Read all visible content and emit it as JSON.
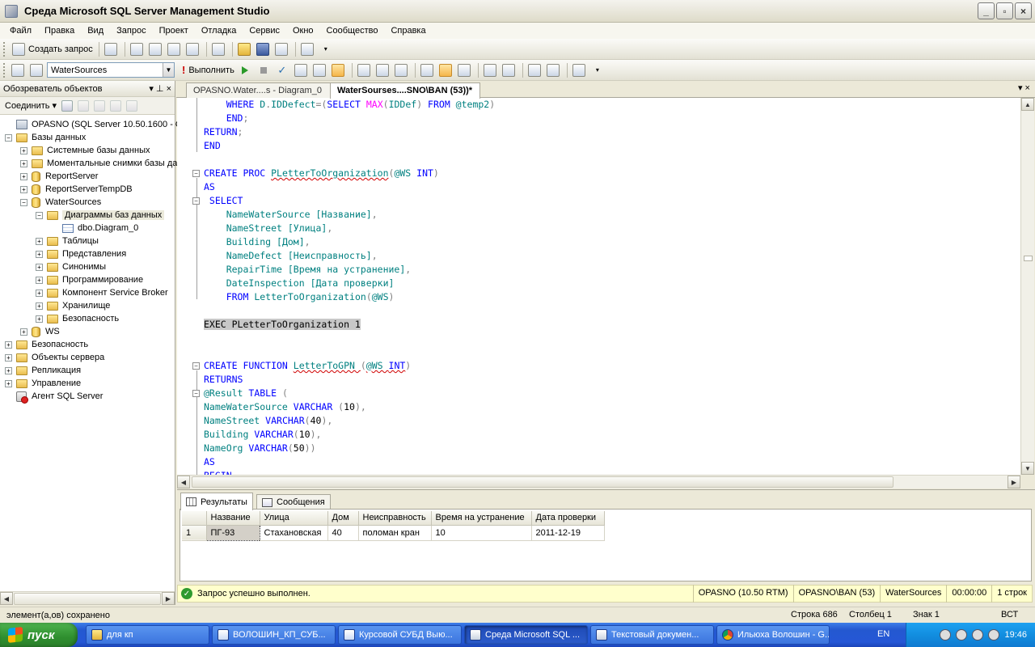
{
  "window": {
    "title": "Среда Microsoft SQL Server Management Studio",
    "buttons": [
      "_",
      "▫",
      "×"
    ]
  },
  "menu": [
    "Файл",
    "Правка",
    "Вид",
    "Запрос",
    "Проект",
    "Отладка",
    "Сервис",
    "Окно",
    "Сообщество",
    "Справка"
  ],
  "toolbar1": {
    "new_query_label": "Создать запрос"
  },
  "toolbar2": {
    "database": "WaterSources",
    "execute_label": "Выполнить"
  },
  "object_explorer": {
    "title": "Обозреватель объектов",
    "pin": "▾ ⊥ ×",
    "connect_label": "Соединить ▾",
    "tree": [
      {
        "level": 0,
        "icon": "server-icon",
        "exp": "none",
        "label": "OPASNO (SQL Server 10.50.1600 - OPASN"
      },
      {
        "level": 0,
        "icon": "folder-icon",
        "exp": "−",
        "label": "Базы данных"
      },
      {
        "level": 1,
        "icon": "folder-icon",
        "exp": "+",
        "label": "Системные базы данных"
      },
      {
        "level": 1,
        "icon": "folder-icon",
        "exp": "+",
        "label": "Моментальные снимки базы данн"
      },
      {
        "level": 1,
        "icon": "database-icon",
        "exp": "+",
        "label": "ReportServer"
      },
      {
        "level": 1,
        "icon": "database-icon",
        "exp": "+",
        "label": "ReportServerTempDB"
      },
      {
        "level": 1,
        "icon": "database-icon",
        "exp": "−",
        "label": "WaterSources"
      },
      {
        "level": 2,
        "icon": "folder-icon",
        "exp": "−",
        "label": "Диаграммы баз данных",
        "selected": true
      },
      {
        "level": 3,
        "icon": "diagram-icon",
        "exp": "none",
        "label": "dbo.Diagram_0"
      },
      {
        "level": 2,
        "icon": "folder-icon",
        "exp": "+",
        "label": "Таблицы"
      },
      {
        "level": 2,
        "icon": "folder-icon",
        "exp": "+",
        "label": "Представления"
      },
      {
        "level": 2,
        "icon": "folder-icon",
        "exp": "+",
        "label": "Синонимы"
      },
      {
        "level": 2,
        "icon": "folder-icon",
        "exp": "+",
        "label": "Программирование"
      },
      {
        "level": 2,
        "icon": "folder-icon",
        "exp": "+",
        "label": "Компонент Service Broker"
      },
      {
        "level": 2,
        "icon": "folder-icon",
        "exp": "+",
        "label": "Хранилище"
      },
      {
        "level": 2,
        "icon": "folder-icon",
        "exp": "+",
        "label": "Безопасность"
      },
      {
        "level": 1,
        "icon": "database-icon",
        "exp": "+",
        "label": "WS"
      },
      {
        "level": 0,
        "icon": "folder-icon",
        "exp": "+",
        "label": "Безопасность"
      },
      {
        "level": 0,
        "icon": "folder-icon",
        "exp": "+",
        "label": "Объекты сервера"
      },
      {
        "level": 0,
        "icon": "folder-icon",
        "exp": "+",
        "label": "Репликация"
      },
      {
        "level": 0,
        "icon": "folder-icon",
        "exp": "+",
        "label": "Управление"
      },
      {
        "level": 0,
        "icon": "agent-icon",
        "exp": "none",
        "label": "Агент SQL Server"
      }
    ]
  },
  "doc_tabs": {
    "inactive": "OPASNO.Water....s - Diagram_0",
    "active": "WaterSourses....SNO\\BAN (53))*",
    "controls": "▾ ×"
  },
  "editor": {
    "lines": [
      [
        [
          "    ",
          "tx"
        ],
        [
          "WHERE ",
          "kw"
        ],
        [
          "D",
          "id"
        ],
        [
          ".",
          "gr"
        ],
        [
          "IDDefect",
          "id"
        ],
        [
          "=(",
          "gr"
        ],
        [
          "SELECT ",
          "kw"
        ],
        [
          "MAX",
          "fn"
        ],
        [
          "(",
          "gr"
        ],
        [
          "IDDef",
          "id"
        ],
        [
          ") ",
          "gr"
        ],
        [
          "FROM ",
          "kw"
        ],
        [
          "@temp2",
          "id"
        ],
        [
          ")",
          "gr"
        ]
      ],
      [
        [
          "    ",
          "tx"
        ],
        [
          "END",
          "kw"
        ],
        [
          ";",
          "gr"
        ]
      ],
      [
        [
          "RETURN",
          "kw"
        ],
        [
          ";",
          "gr"
        ]
      ],
      [
        [
          "END",
          "kw"
        ]
      ],
      [
        [
          "",
          "tx"
        ]
      ],
      [
        [
          "CREATE ",
          "kw"
        ],
        [
          "PROC ",
          "kw"
        ],
        [
          "PLetterToOrganization",
          "id sq"
        ],
        [
          "(",
          "gr"
        ],
        [
          "@WS ",
          "id"
        ],
        [
          "INT",
          "kw"
        ],
        [
          ")",
          "gr"
        ]
      ],
      [
        [
          "AS",
          "kw"
        ]
      ],
      [
        [
          " SELECT",
          "kw"
        ]
      ],
      [
        [
          "    ",
          "tx"
        ],
        [
          "NameWaterSource ",
          "id"
        ],
        [
          "[Название]",
          "id"
        ],
        [
          ",",
          "gr"
        ]
      ],
      [
        [
          "    ",
          "tx"
        ],
        [
          "NameStreet ",
          "id"
        ],
        [
          "[Улица]",
          "id"
        ],
        [
          ",",
          "gr"
        ]
      ],
      [
        [
          "    ",
          "tx"
        ],
        [
          "Building ",
          "id"
        ],
        [
          "[Дом]",
          "id"
        ],
        [
          ",",
          "gr"
        ]
      ],
      [
        [
          "    ",
          "tx"
        ],
        [
          "NameDefect ",
          "id"
        ],
        [
          "[Неисправность]",
          "id"
        ],
        [
          ",",
          "gr"
        ]
      ],
      [
        [
          "    ",
          "tx"
        ],
        [
          "RepairTime ",
          "id"
        ],
        [
          "[Время на устранение]",
          "id"
        ],
        [
          ",",
          "gr"
        ]
      ],
      [
        [
          "    ",
          "tx"
        ],
        [
          "DateInspection ",
          "id"
        ],
        [
          "[Дата проверки]",
          "id"
        ]
      ],
      [
        [
          "    ",
          "tx"
        ],
        [
          "FROM ",
          "kw"
        ],
        [
          "LetterToOrganization",
          "id"
        ],
        [
          "(",
          "gr"
        ],
        [
          "@WS",
          "id"
        ],
        [
          ")",
          "gr"
        ]
      ],
      [
        [
          "",
          "tx"
        ]
      ],
      [
        [
          "EXEC PLetterToOrganization 1",
          "tx hl"
        ]
      ],
      [
        [
          "",
          "tx"
        ]
      ],
      [
        [
          "",
          "tx"
        ]
      ],
      [
        [
          "CREATE ",
          "kw"
        ],
        [
          "FUNCTION ",
          "kw"
        ],
        [
          "LetterToGPN ",
          "id sq"
        ],
        [
          "(",
          "gr"
        ],
        [
          "@WS ",
          "id sq"
        ],
        [
          "INT",
          "kw sq"
        ],
        [
          ")",
          "gr"
        ]
      ],
      [
        [
          "RETURNS",
          "kw"
        ]
      ],
      [
        [
          "@Result ",
          "id"
        ],
        [
          "TABLE ",
          "kw"
        ],
        [
          "(",
          "gr"
        ]
      ],
      [
        [
          "NameWaterSource ",
          "id"
        ],
        [
          "VARCHAR ",
          "kw"
        ],
        [
          "(",
          "gr"
        ],
        [
          "10",
          "tx"
        ],
        [
          "),",
          "gr"
        ]
      ],
      [
        [
          "NameStreet ",
          "id"
        ],
        [
          "VARCHAR",
          "kw"
        ],
        [
          "(",
          "gr"
        ],
        [
          "40",
          "tx"
        ],
        [
          "),",
          "gr"
        ]
      ],
      [
        [
          "Building ",
          "id"
        ],
        [
          "VARCHAR",
          "kw"
        ],
        [
          "(",
          "gr"
        ],
        [
          "10",
          "tx"
        ],
        [
          "),",
          "gr"
        ]
      ],
      [
        [
          "NameOrg ",
          "id"
        ],
        [
          "VARCHAR",
          "kw"
        ],
        [
          "(",
          "gr"
        ],
        [
          "50",
          "tx"
        ],
        [
          "))",
          "gr"
        ]
      ],
      [
        [
          "AS",
          "kw"
        ]
      ],
      [
        [
          "BEGIN",
          "kw"
        ]
      ]
    ]
  },
  "results": {
    "tab_results": "Результаты",
    "tab_messages": "Сообщения",
    "columns": [
      "Название",
      "Улица",
      "Дом",
      "Неисправность",
      "Время на устранение",
      "Дата проверки"
    ],
    "rows": [
      {
        "num": "1",
        "cells": [
          "ПГ-93",
          "Стахановская",
          "40",
          "поломан кран",
          "10",
          "2011-12-19"
        ]
      }
    ]
  },
  "query_status": {
    "message": "Запрос успешно выполнен.",
    "server": "OPASNO (10.50 RTM)",
    "user": "OPASNO\\BAN (53)",
    "database": "WaterSources",
    "time": "00:00:00",
    "rows": "1 строк"
  },
  "statusbar": {
    "left": "элемент(а,ов) сохранено",
    "line": "Строка 686",
    "col": "Столбец 1",
    "char": "Знак 1",
    "mode": "ВСТ"
  },
  "taskbar": {
    "start": "пуск",
    "tasks": [
      {
        "label": "для кп",
        "icon": "folder"
      },
      {
        "label": "ВОЛОШИН_КП_СУБ...",
        "icon": "word"
      },
      {
        "label": "Курсовой СУБД Выю...",
        "icon": "word"
      },
      {
        "label": "Среда Microsoft SQL ...",
        "icon": "ssms",
        "active": true
      },
      {
        "label": "Текстовый докумен...",
        "icon": "doc"
      },
      {
        "label": "Ильюха Волошин - G...",
        "icon": "chrome"
      }
    ],
    "lang": "EN",
    "clock": "19:46"
  }
}
